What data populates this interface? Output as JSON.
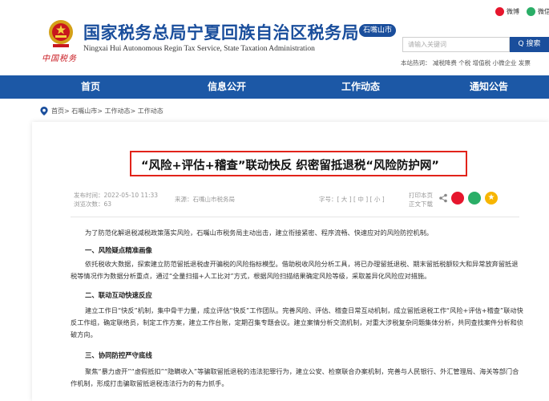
{
  "header": {
    "org_title": "国家税务总局宁夏回族自治区税务局",
    "org_subtitle": "Ningxai Hui Autonomous Regin Tax Service, State Taxation Administration",
    "city_badge": "石嘴山市",
    "logo_script": "中国税务",
    "social": {
      "weibo": "微博",
      "weixin": "微信"
    },
    "search": {
      "placeholder": "请输入关键词",
      "button": "Q 搜索"
    },
    "hot_words": "本站热词： 减税降费 个税 增值税 小微企业 发票"
  },
  "nav": [
    "首页",
    "信息公开",
    "工作动态",
    "通知公告"
  ],
  "breadcrumb": "首页> 石嘴山市> 工作动态> 工作动态",
  "article": {
    "title": "“风险+评估+稽查”联动快反 织密留抵退税“风险防护网”",
    "publish_time": "发布时间：2022-05-10 11:33",
    "views": "浏览次数：63",
    "source": "来源：石嘴山市税务局",
    "font_size": "字号：[ 大 ] [ 中 ] [ 小 ]",
    "print": "打印本页",
    "download": "正文下载",
    "intro": "为了防范化解退税减税政策落实风险，石嘴山市税务局主动出击，建立衔接紧密、程序流畅、快速应对的风险防控机制。",
    "sections": [
      {
        "heading": "一、风险疑点精准画像",
        "body": "依托税收大数据，探索建立防范留抵退税虚开骗税的风险指标模型。借助税收风险分析工具，将已办理留抵退税、期末留抵税额较大和异常放弃留抵退税等情况作为数据分析重点，通过“全量扫描+人工比对”方式，根据风险扫描结果确定风险等级，采取差异化风险应对措施。"
      },
      {
        "heading": "二、联动互动快速反应",
        "body": "建立工作日“快反”机制，集中骨干力量，成立评估“快反”工作团队。完善风险、评估、稽查日常互动机制，成立留抵退税工作“风险+评估+稽查”联动快反工作组，确定联络员，制定工作方案，建立工作台账，定期召集专题会议。建立案情分析交流机制，对重大涉税复杂问题集体分析，共同查找案件分析和侦破方向。"
      },
      {
        "heading": "三、协同防控严守底线",
        "body": "聚焦“暴力虚开”“虚假抵扣”“隐瞒收入”等骗取留抵退税的违法犯罪行为，建立公安、检察联合办案机制，完善与人民银行、外汇管理局、海关等部门合作机制，形成打击骗取留抵退税违法行为的有力抓手。"
      }
    ]
  },
  "colors": {
    "brand_blue": "#1a4e9c",
    "nav_blue": "#1c58a6",
    "title_border": "#e2231a",
    "weibo_red": "#e6162d",
    "weixin_green": "#2aae67",
    "favorite_orange": "#f7b500"
  }
}
